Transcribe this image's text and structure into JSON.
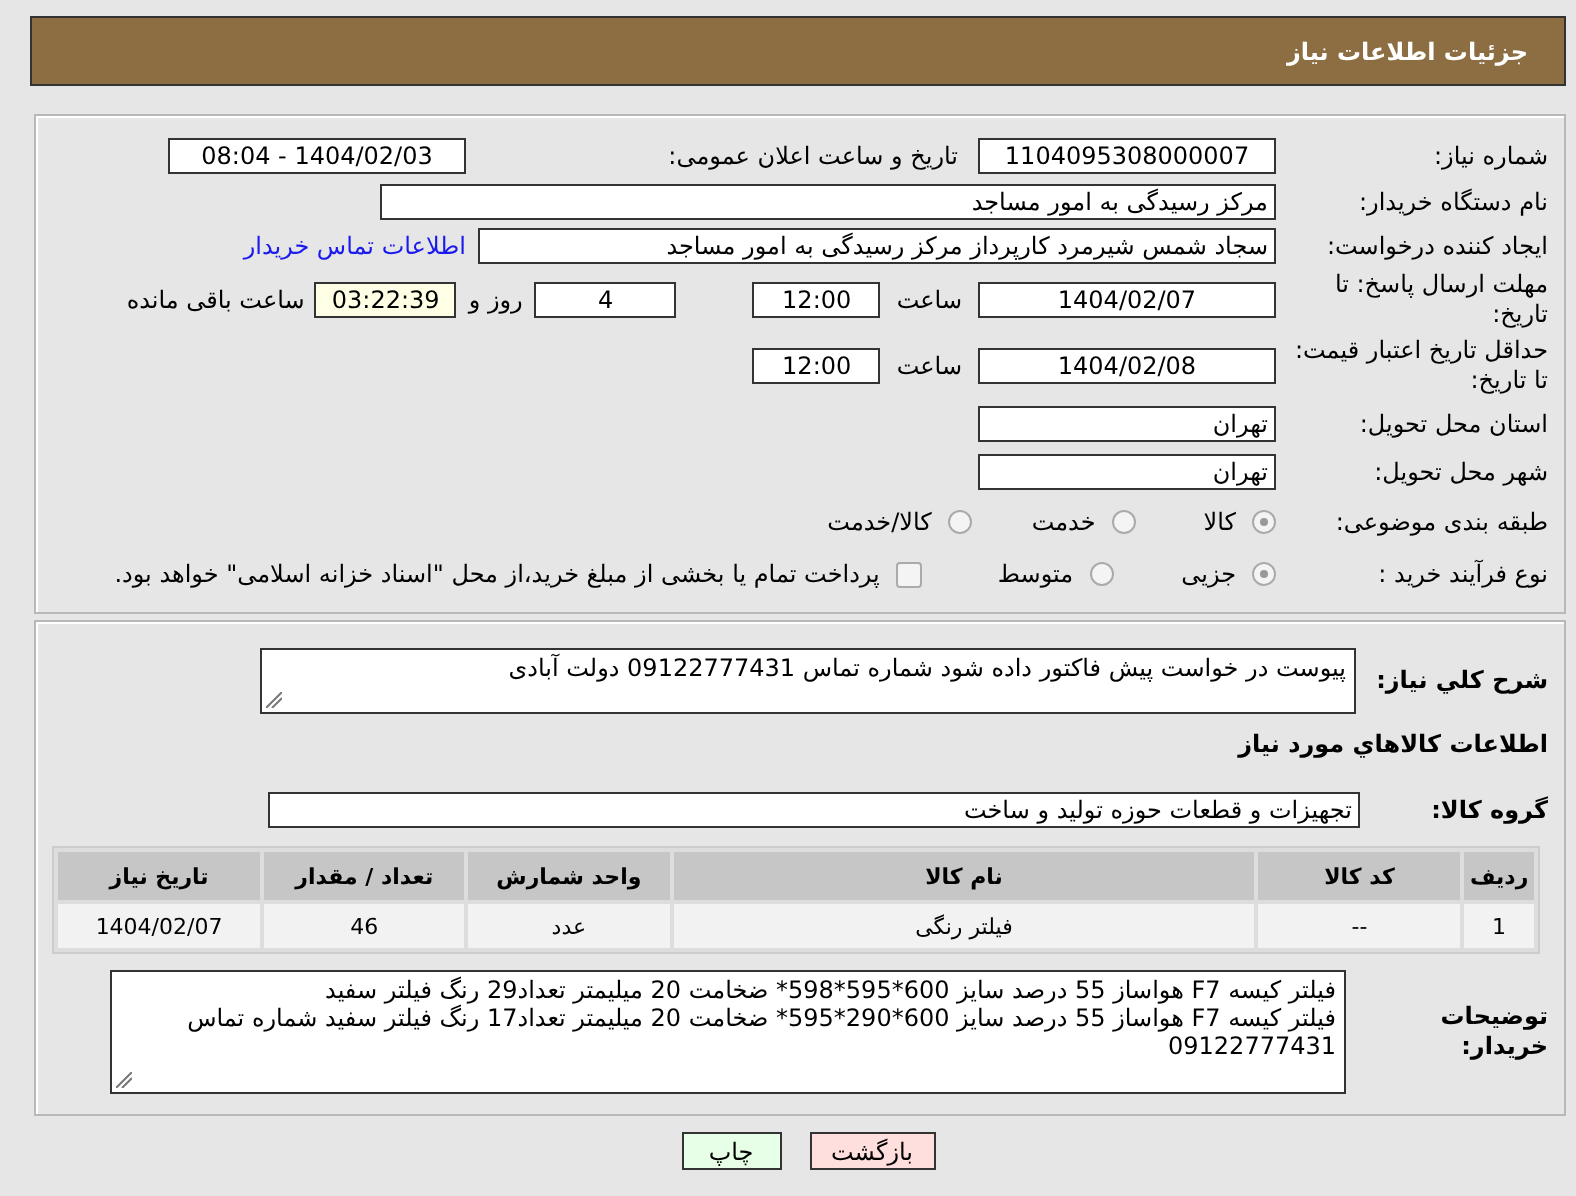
{
  "header": {
    "title": "جزئیات اطلاعات نیاز"
  },
  "need_number": {
    "label": "شماره نیاز:",
    "value": "1104095308000007"
  },
  "announce": {
    "label": "تاریخ و ساعت اعلان عمومی:",
    "value": "1404/02/03 - 08:04"
  },
  "buyer_org": {
    "label": "نام دستگاه خریدار:",
    "value": "مرکز رسیدگی به امور مساجد"
  },
  "creator": {
    "label": "ایجاد کننده درخواست:",
    "value": "سجاد شمس شیرمرد کارپرداز مرکز رسیدگی به امور مساجد",
    "link": "اطلاعات تماس خریدار"
  },
  "reply_deadline": {
    "label": "مهلت ارسال پاسخ: تا تاریخ:",
    "date": "1404/02/07",
    "time_label": "ساعت",
    "time": "12:00",
    "days": "4",
    "days_label": "روز و",
    "remaining": "03:22:39",
    "remaining_label": "ساعت باقی مانده"
  },
  "price_validity": {
    "label": "حداقل تاریخ اعتبار قیمت: تا تاریخ:",
    "date": "1404/02/08",
    "time_label": "ساعت",
    "time": "12:00"
  },
  "province": {
    "label": "استان محل تحویل:",
    "value": "تهران"
  },
  "city": {
    "label": "شهر محل تحویل:",
    "value": "تهران"
  },
  "category": {
    "label": "طبقه بندی موضوعی:",
    "options": [
      {
        "label": "کالا",
        "selected": true
      },
      {
        "label": "خدمت",
        "selected": false
      },
      {
        "label": "کالا/خدمت",
        "selected": false
      }
    ]
  },
  "process": {
    "label": "نوع فرآیند خرید :",
    "options": [
      {
        "label": "جزیی",
        "selected": true
      },
      {
        "label": "متوسط",
        "selected": false
      }
    ],
    "treasury": {
      "checked": false,
      "text": "پرداخت تمام یا بخشی از مبلغ خرید،از محل \"اسناد خزانه اسلامی\" خواهد بود."
    }
  },
  "description": {
    "label": "شرح کلي نياز:",
    "value": "پیوست در خواست پیش فاکتور داده شود شماره تماس 09122777431 دولت آبادی"
  },
  "goods_title": "اطلاعات كالاهاي مورد نياز",
  "goods_group": {
    "label": "گروه کالا:",
    "value": "تجهیزات و قطعات حوزه تولید و ساخت"
  },
  "table": {
    "columns": [
      "ردیف",
      "کد کالا",
      "نام کالا",
      "واحد شمارش",
      "تعداد / مقدار",
      "تاریخ نیاز"
    ],
    "rows": [
      [
        "1",
        "--",
        "فیلتر رنگی",
        "عدد",
        "46",
        "1404/02/07"
      ]
    ]
  },
  "buyer_notes": {
    "label": "توضیحات خریدار:",
    "lines": [
      "فیلتر کیسه F7 هواساز 55 درصد سایز 600*595*598* ضخامت 20 میلیمتر تعداد29 رنگ فیلتر سفید",
      "فیلتر کیسه F7 هواساز 55 درصد سایز 600*290*595* ضخامت 20 میلیمتر تعداد17 رنگ فیلتر سفید شماره تماس",
      "09122777431"
    ]
  },
  "buttons": [
    {
      "label": "بازگشت",
      "kind": "back"
    },
    {
      "label": "چاپ",
      "kind": "print"
    }
  ]
}
